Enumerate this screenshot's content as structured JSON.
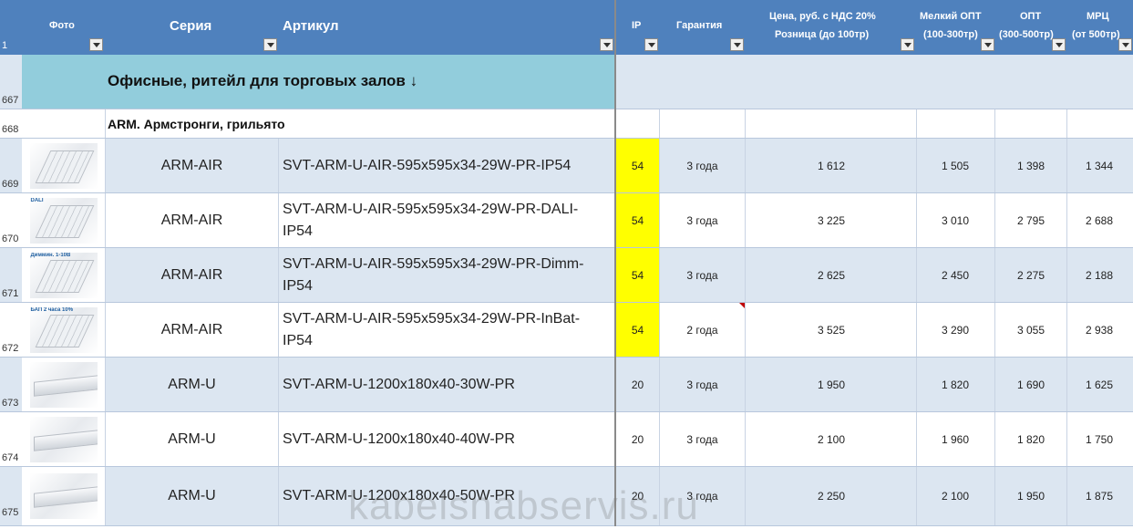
{
  "header": {
    "row_number": "1",
    "photo": "Фото",
    "series": "Серия",
    "article": "Артикул",
    "ip": "IP",
    "warranty": "Гарантия",
    "price_line1": "Цена, руб. с НДС 20%",
    "price_line2": "Розница (до 100тр)",
    "small_wholesale_line1": "Мелкий ОПТ",
    "small_wholesale_line2": "(100-300тр)",
    "wholesale_line1": "ОПТ",
    "wholesale_line2": "(300-500тр)",
    "mrc_line1": "МРЦ",
    "mrc_line2": "(от 500тр)"
  },
  "section": {
    "row_number": "667",
    "title": "Офисные, ритейл для торговых залов ↓"
  },
  "group": {
    "row_number": "668",
    "title": "ARM. Армстронги, грильято"
  },
  "rows": [
    {
      "num": "669",
      "series": "ARM-AIR",
      "article_1": "SVT-ARM-U-AIR-595x595x34-29W-PR-IP54",
      "article_2": "",
      "ip": "54",
      "warranty": "3 года",
      "retail": "1 612",
      "small": "1 505",
      "opt": "1 398",
      "mrc": "1 344",
      "thumb": "panel",
      "tag": ""
    },
    {
      "num": "670",
      "series": "ARM-AIR",
      "article_1": "SVT-ARM-U-AIR-595x595x34-29W-PR-DALI-",
      "article_2": "IP54",
      "ip": "54",
      "warranty": "3 года",
      "retail": "3 225",
      "small": "3 010",
      "opt": "2 795",
      "mrc": "2 688",
      "thumb": "panel",
      "tag": "DALI"
    },
    {
      "num": "671",
      "series": "ARM-AIR",
      "article_1": "SVT-ARM-U-AIR-595x595x34-29W-PR-Dimm-",
      "article_2": "IP54",
      "ip": "54",
      "warranty": "3 года",
      "retail": "2 625",
      "small": "2 450",
      "opt": "2 275",
      "mrc": "2 188",
      "thumb": "panel",
      "tag": "Диммин. 1-10В"
    },
    {
      "num": "672",
      "series": "ARM-AIR",
      "article_1": "SVT-ARM-U-AIR-595x595x34-29W-PR-InBat-",
      "article_2": "IP54",
      "ip": "54",
      "warranty": "2 года",
      "retail": "3 525",
      "small": "3 290",
      "opt": "3 055",
      "mrc": "2 938",
      "thumb": "panel",
      "tag": "БАП 2 часа 10%"
    },
    {
      "num": "673",
      "series": "ARM-U",
      "article_1": "SVT-ARM-U-1200x180x40-30W-PR",
      "article_2": "",
      "ip": "20",
      "warranty": "3 года",
      "retail": "1 950",
      "small": "1 820",
      "opt": "1 690",
      "mrc": "1 625",
      "thumb": "bar",
      "tag": ""
    },
    {
      "num": "674",
      "series": "ARM-U",
      "article_1": "SVT-ARM-U-1200x180x40-40W-PR",
      "article_2": "",
      "ip": "20",
      "warranty": "3 года",
      "retail": "2 100",
      "small": "1 960",
      "opt": "1 820",
      "mrc": "1 750",
      "thumb": "bar",
      "tag": ""
    },
    {
      "num": "675",
      "series": "ARM-U",
      "article_1": "SVT-ARM-U-1200x180x40-50W-PR",
      "article_2": "",
      "ip": "20",
      "warranty": "3 года",
      "retail": "2 250",
      "small": "2 100",
      "opt": "1 950",
      "mrc": "1 875",
      "thumb": "bar",
      "tag": ""
    }
  ],
  "watermark": "kabelsnabservis.ru",
  "colors": {
    "header": "#4f81bd",
    "section": "#92cddc",
    "band": "#dce6f1",
    "ip_highlight": "#ffff00"
  }
}
